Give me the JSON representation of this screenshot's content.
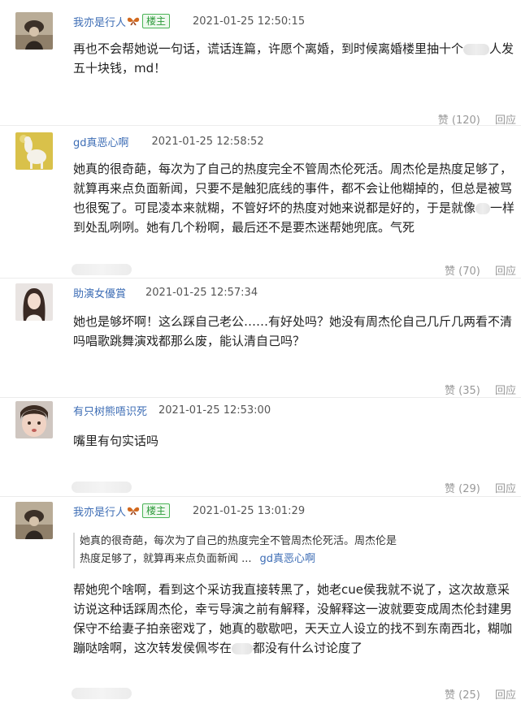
{
  "comments": [
    {
      "user": "我亦是行人",
      "badge": "楼主",
      "time": "2021-01-25 12:50:15",
      "text_parts": [
        "再也不会帮她说一句话，谎话连篇，许愿个离婚，到时候离婚楼里抽十个",
        "人发五十块钱，md！"
      ],
      "likes": "赞 (120)",
      "reply": "回应"
    },
    {
      "user": "gd真恶心啊",
      "time": "2021-01-25 12:58:52",
      "text_parts": [
        "她真的很奇葩，每次为了自己的热度完全不管周杰伦死活。周杰伦是热度足够了，就算再来点负面新闻，只要不是触犯底线的事件，都不会让他糊掉的，但总是被骂也很冤了。可昆凌本来就糊，不管好坏的热度对她来说都是好的，于是就像",
        "一样到处乱咧咧。她有几个粉啊，最后还不是要杰迷帮她兜底。气死"
      ],
      "likes": "赞 (70)",
      "reply": "回应"
    },
    {
      "user": "助演女優賞",
      "time": "2021-01-25 12:57:34",
      "text": "她也是够坏啊！这么踩自己老公……有好处吗？她没有周杰伦自己几斤几两看不清吗唱歌跳舞演戏都那么废，能认清自己吗？",
      "likes": "赞 (35)",
      "reply": "回应"
    },
    {
      "user": "有只树熊唔识死",
      "time": "2021-01-25 12:53:00",
      "text": "嘴里有句实话吗",
      "likes": "赞 (29)",
      "reply": "回应"
    },
    {
      "user": "我亦是行人",
      "badge": "楼主",
      "time": "2021-01-25 13:01:29",
      "quote_line1": "她真的很奇葩，每次为了自己的热度完全不管周杰伦死活。周杰伦是",
      "quote_line2": "热度足够了，就算再来点负面新闻 ...",
      "quote_author": "gd真恶心啊",
      "text_parts": [
        "帮她兜个啥啊，看到这个采访我直接转黑了，她老cue侯我就不说了，这次故意采访说这种话踩周杰伦，幸亏导演之前有解释，没解释这一波就要变成周杰伦封建男保守不给妻子拍亲密戏了，她真的歇歇吧，天天立人设立的找不到东南西北，糊咖蹦哒啥啊，这次转发侯佩岑在",
        "都没有什么讨论度了"
      ],
      "likes": "赞 (25)",
      "reply": "回应"
    }
  ],
  "colors": {
    "username": "#3d6db5",
    "badge_green": "#2c9a3a",
    "muted": "#999999"
  },
  "icons": [
    "butterfly-icon"
  ]
}
